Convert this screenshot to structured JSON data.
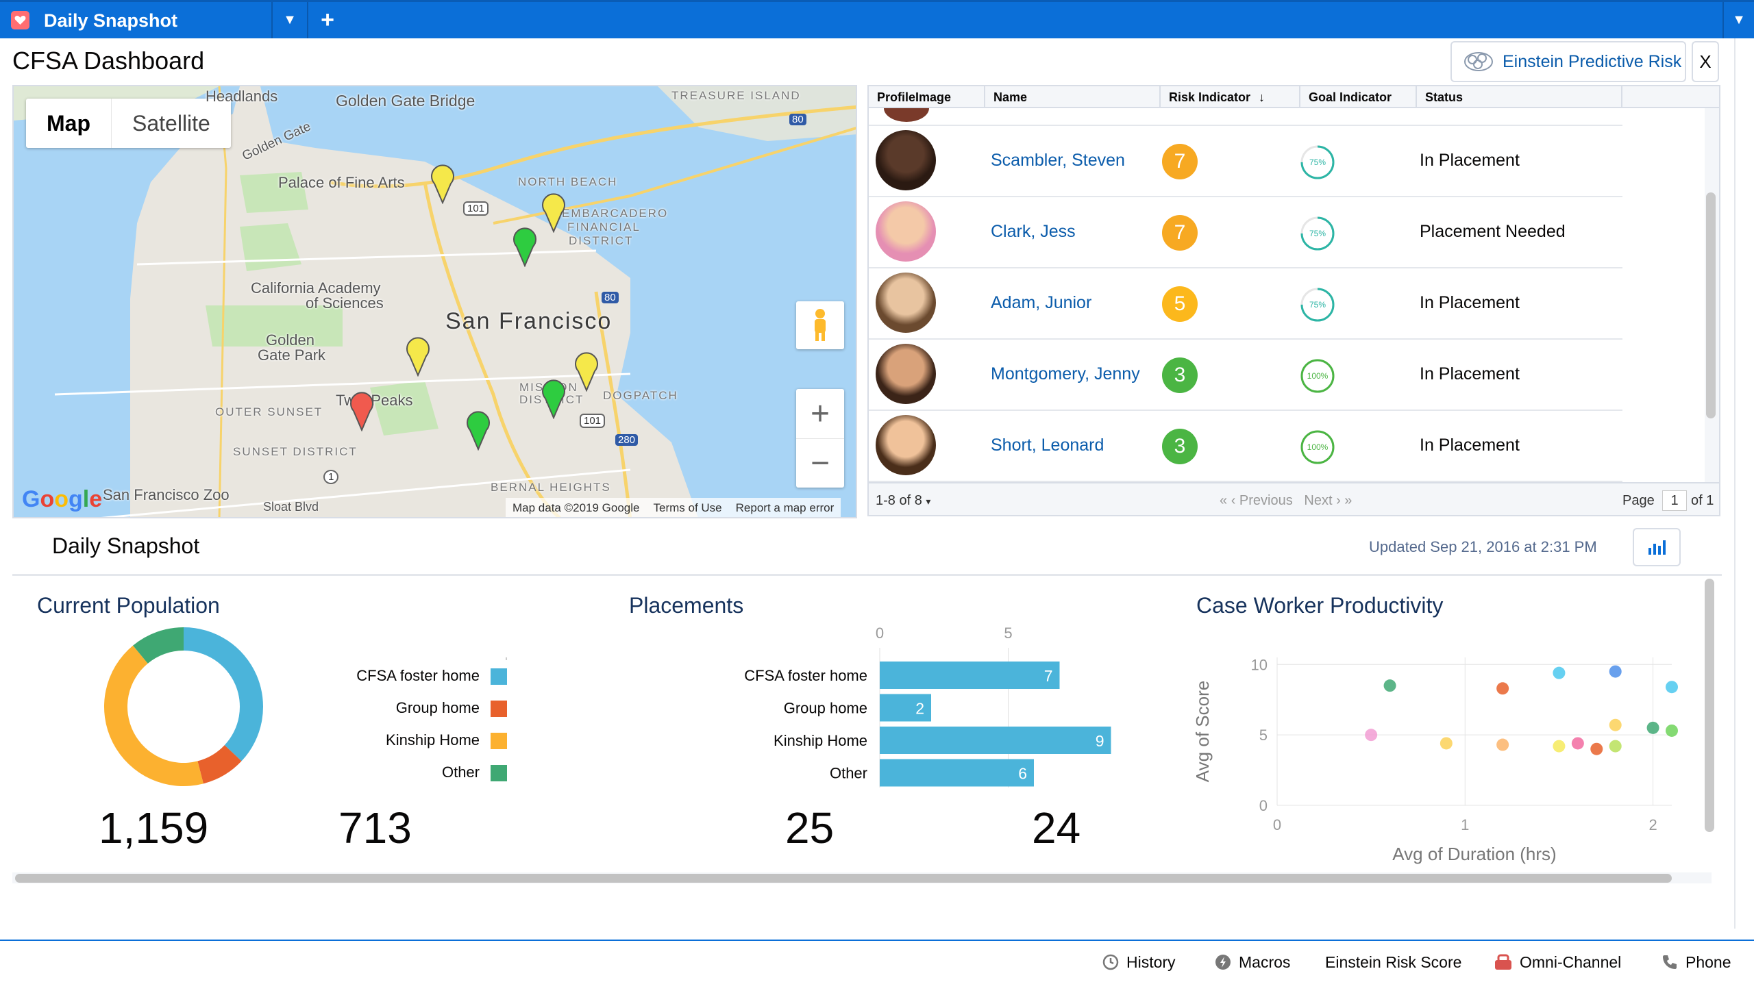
{
  "tabbar": {
    "active_tab": "Daily Snapshot",
    "dropdown_icon": "chevron-down-icon",
    "add_icon": "plus-icon",
    "overflow_icon": "chevron-down-icon"
  },
  "header": {
    "title": "CFSA Dashboard",
    "einstein_button": "Einstein Predictive Risk",
    "close_label": "X"
  },
  "map": {
    "type_map": "Map",
    "type_satellite": "Satellite",
    "labels": {
      "headlands": "Headlands",
      "golden_gate_bridge": "Golden Gate Bridge",
      "treasure_island": "TREASURE ISLAND",
      "golden_gate": "Golden Gate",
      "palace": "Palace of Fine Arts",
      "north_beach": "NORTH BEACH",
      "embarcadero": "EMBARCADERO",
      "financial": "FINANCIAL",
      "district": "DISTRICT",
      "cal_academy_1": "California Academy",
      "cal_academy_2": "of Sciences",
      "sf": "San Francisco",
      "gg_park_1": "Golden",
      "gg_park_2": "Gate Park",
      "outer_sunset": "OUTER SUNSET",
      "twin_peaks": "Twin Peaks",
      "mission": "MISSION",
      "district2": "DISTRICT",
      "dogpatch": "DOGPATCH",
      "sunset_district": "SUNSET DISTRICT",
      "bernal": "BERNAL HEIGHTS",
      "zoo": "San Francisco Zoo",
      "sloat": "Sloat Blvd",
      "hw_101a": "101",
      "hw_101b": "101",
      "hw_80a": "80",
      "hw_80b": "80",
      "hw_280": "280",
      "hw_1": "1"
    },
    "google": "Google",
    "footer": [
      "Map data ©2019 Google",
      "Terms of Use",
      "Report a map error"
    ],
    "pin_colors": {
      "yellow": "#f5e84a",
      "green": "#2ecc40",
      "red": "#f05a4e"
    }
  },
  "table": {
    "columns": [
      "ProfileImage",
      "Name",
      "Risk Indicator",
      "Goal Indicator",
      "Status"
    ],
    "sort_icon": "arrow-down-icon",
    "rows": [
      {
        "name": "Scambler, Steven",
        "risk": "7",
        "risk_color": "#f7a922",
        "goal": "75%",
        "goal_pct": 0.75,
        "status": "In Placement"
      },
      {
        "name": "Clark, Jess",
        "risk": "7",
        "risk_color": "#f7a922",
        "goal": "75%",
        "goal_pct": 0.75,
        "status": "Placement Needed"
      },
      {
        "name": "Adam, Junior",
        "risk": "5",
        "risk_color": "#fcb81c",
        "goal": "75%",
        "goal_pct": 0.75,
        "status": "In Placement"
      },
      {
        "name": "Montgomery, Jenny",
        "risk": "3",
        "risk_color": "#4bb543",
        "goal": "100%",
        "goal_pct": 1.0,
        "status": "In Placement"
      },
      {
        "name": "Short, Leonard",
        "risk": "3",
        "risk_color": "#4bb543",
        "goal": "100%",
        "goal_pct": 1.0,
        "status": "In Placement"
      }
    ],
    "record_count": "1-8 of 8",
    "previous": "Previous",
    "next": "Next",
    "page_label": "Page",
    "page_value": "1",
    "of_label": "of 1"
  },
  "snapshot": {
    "title": "Daily Snapshot",
    "updated": "Updated Sep 21, 2016 at 2:31 PM",
    "chart_icon": "bar-chart-icon"
  },
  "population": {
    "title": "Current Population",
    "total": "1,159",
    "secondary": "713",
    "legend": [
      {
        "label": "CFSA foster home",
        "color": "#4bb4da"
      },
      {
        "label": "Group home",
        "color": "#e8612c"
      },
      {
        "label": "Kinship Home",
        "color": "#fcb130"
      },
      {
        "label": "Other",
        "color": "#3fa873"
      }
    ]
  },
  "placements": {
    "title": "Placements",
    "stat_a": "25",
    "stat_b": "24"
  },
  "productivity": {
    "title": "Case Worker Productivity"
  },
  "chart_data": [
    {
      "type": "pie",
      "title": "Current Population",
      "categories": [
        "CFSA foster home",
        "Group home",
        "Kinship Home",
        "Other"
      ],
      "values": [
        37,
        9,
        43,
        11
      ]
    },
    {
      "type": "bar",
      "title": "Placements",
      "categories": [
        "CFSA foster home",
        "Group home",
        "Kinship Home",
        "Other"
      ],
      "values": [
        7,
        2,
        9,
        6
      ],
      "xlim": [
        0,
        10
      ],
      "ticks": [
        "0",
        "5"
      ]
    },
    {
      "type": "scatter",
      "title": "Case Worker Productivity",
      "xlabel": "Avg of Duration (hrs)",
      "ylabel": "Avg of Score",
      "xlim": [
        0,
        2.1
      ],
      "ylim": [
        0,
        10.5
      ],
      "xticks": [
        "0",
        "1",
        "2"
      ],
      "yticks": [
        "0",
        "5",
        "10"
      ],
      "points": [
        {
          "x": 0.6,
          "y": 8.5,
          "color": "#3fa873"
        },
        {
          "x": 1.2,
          "y": 8.3,
          "color": "#e8612c"
        },
        {
          "x": 1.5,
          "y": 9.4,
          "color": "#4bc8ef"
        },
        {
          "x": 1.8,
          "y": 9.5,
          "color": "#4e8fea"
        },
        {
          "x": 2.1,
          "y": 8.4,
          "color": "#4bc8ef"
        },
        {
          "x": 0.5,
          "y": 5.0,
          "color": "#f29ed3"
        },
        {
          "x": 0.9,
          "y": 4.4,
          "color": "#fcd158"
        },
        {
          "x": 1.2,
          "y": 4.3,
          "color": "#fcb46a"
        },
        {
          "x": 1.5,
          "y": 4.2,
          "color": "#f6ea5c"
        },
        {
          "x": 1.6,
          "y": 4.4,
          "color": "#f26ba0"
        },
        {
          "x": 1.7,
          "y": 4.0,
          "color": "#e8612c"
        },
        {
          "x": 1.8,
          "y": 4.2,
          "color": "#b8e05a"
        },
        {
          "x": 1.8,
          "y": 5.7,
          "color": "#fcd158"
        },
        {
          "x": 2.0,
          "y": 5.5,
          "color": "#3fa873"
        },
        {
          "x": 2.1,
          "y": 5.3,
          "color": "#6ed35a"
        }
      ]
    }
  ],
  "utility": {
    "history": "History",
    "macros": "Macros",
    "einstein": "Einstein Risk Score",
    "omni": "Omni-Channel",
    "phone": "Phone"
  }
}
